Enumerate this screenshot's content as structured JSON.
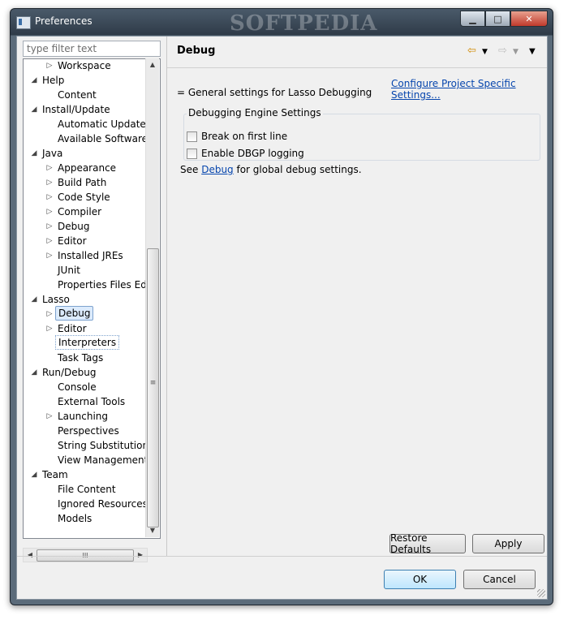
{
  "window": {
    "title": "Preferences",
    "watermark": "SOFTPEDIA",
    "min": "▁",
    "max": "□",
    "close": "✕"
  },
  "filter": {
    "placeholder": "type filter text"
  },
  "tree": [
    {
      "label": "Workspace",
      "indent": 2,
      "expander": "▷"
    },
    {
      "label": "Help",
      "indent": 1,
      "expander": "◢"
    },
    {
      "label": "Content",
      "indent": 2,
      "expander": ""
    },
    {
      "label": "Install/Update",
      "indent": 1,
      "expander": "◢"
    },
    {
      "label": "Automatic Updates",
      "indent": 2,
      "expander": ""
    },
    {
      "label": "Available Software S",
      "indent": 2,
      "expander": ""
    },
    {
      "label": "Java",
      "indent": 1,
      "expander": "◢"
    },
    {
      "label": "Appearance",
      "indent": 2,
      "expander": "▷"
    },
    {
      "label": "Build Path",
      "indent": 2,
      "expander": "▷"
    },
    {
      "label": "Code Style",
      "indent": 2,
      "expander": "▷"
    },
    {
      "label": "Compiler",
      "indent": 2,
      "expander": "▷"
    },
    {
      "label": "Debug",
      "indent": 2,
      "expander": "▷"
    },
    {
      "label": "Editor",
      "indent": 2,
      "expander": "▷"
    },
    {
      "label": "Installed JREs",
      "indent": 2,
      "expander": "▷"
    },
    {
      "label": "JUnit",
      "indent": 2,
      "expander": ""
    },
    {
      "label": "Properties Files Edito",
      "indent": 2,
      "expander": ""
    },
    {
      "label": "Lasso",
      "indent": 1,
      "expander": "◢"
    },
    {
      "label": "Debug",
      "indent": 2,
      "expander": "▷",
      "state": "selected"
    },
    {
      "label": "Editor",
      "indent": 2,
      "expander": "▷"
    },
    {
      "label": "Interpreters",
      "indent": 2,
      "expander": "",
      "state": "focus"
    },
    {
      "label": "Task Tags",
      "indent": 2,
      "expander": ""
    },
    {
      "label": "Run/Debug",
      "indent": 1,
      "expander": "◢"
    },
    {
      "label": "Console",
      "indent": 2,
      "expander": ""
    },
    {
      "label": "External Tools",
      "indent": 2,
      "expander": ""
    },
    {
      "label": "Launching",
      "indent": 2,
      "expander": "▷"
    },
    {
      "label": "Perspectives",
      "indent": 2,
      "expander": ""
    },
    {
      "label": "String Substitution",
      "indent": 2,
      "expander": ""
    },
    {
      "label": "View Management",
      "indent": 2,
      "expander": ""
    },
    {
      "label": "Team",
      "indent": 1,
      "expander": "◢"
    },
    {
      "label": "File Content",
      "indent": 2,
      "expander": ""
    },
    {
      "label": "Ignored Resources",
      "indent": 2,
      "expander": ""
    },
    {
      "label": "Models",
      "indent": 2,
      "expander": ""
    }
  ],
  "scroll": {
    "up": "▲",
    "down": "▼",
    "left": "◀",
    "right": "▶",
    "grip_v": "≡",
    "grip_h": "III"
  },
  "page": {
    "title": "Debug",
    "back_icon": "⇦",
    "forward_icon": "⇨",
    "dropdown": "▼",
    "menu": "▼",
    "configure_link": "Configure Project Specific Settings...",
    "description": "= General settings for Lasso Debugging",
    "group_label": "Debugging Engine Settings",
    "check1": "Break on first line",
    "check2": "Enable DBGP logging",
    "see_prefix": "See ",
    "see_link": "Debug",
    "see_suffix": " for global debug settings.",
    "restore_defaults": "Restore Defaults",
    "apply": "Apply"
  },
  "dialog": {
    "ok": "OK",
    "cancel": "Cancel"
  },
  "colors": {
    "accent": "#3c7fb1",
    "link": "#0645ad",
    "selection": "#dcebfc"
  }
}
